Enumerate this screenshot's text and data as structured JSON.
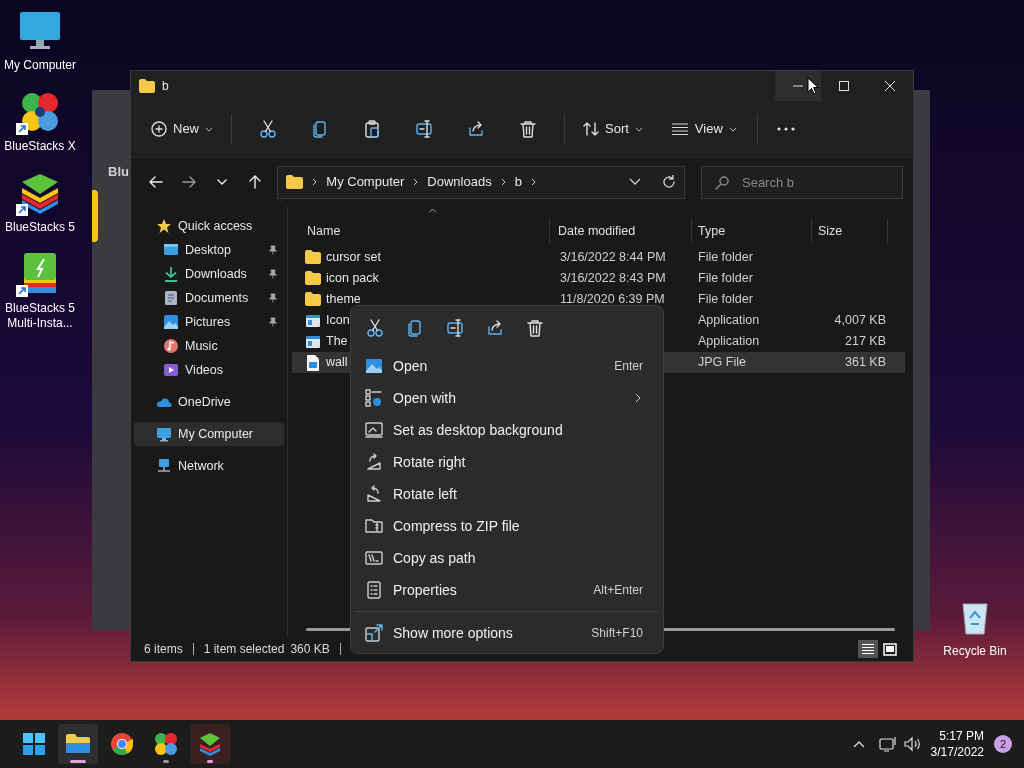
{
  "desktop_icons": [
    {
      "label": "My Computer",
      "kind": "monitor",
      "shortcut": false
    },
    {
      "label": "BlueStacks X",
      "kind": "bsx",
      "shortcut": true
    },
    {
      "label": "BlueStacks 5",
      "kind": "bs5",
      "shortcut": true
    },
    {
      "label": "BlueStacks 5 Multi-Insta...",
      "kind": "bs5multi",
      "shortcut": true
    }
  ],
  "recycle_bin": {
    "label": "Recycle Bin"
  },
  "background_window": {
    "text": "Blu"
  },
  "window": {
    "title": "b",
    "toolbar": {
      "new": "New",
      "sort": "Sort",
      "view": "View"
    },
    "address": {
      "segments": [
        "My Computer",
        "Downloads",
        "b"
      ]
    },
    "search": {
      "placeholder": "Search b"
    },
    "sidebar": [
      {
        "label": "Quick access",
        "kind": "star",
        "selected": false,
        "pinned": false,
        "children": [
          {
            "label": "Desktop",
            "kind": "desktop",
            "selected": false,
            "pinned": true
          },
          {
            "label": "Downloads",
            "kind": "download",
            "selected": false,
            "pinned": true
          },
          {
            "label": "Documents",
            "kind": "document",
            "selected": false,
            "pinned": true
          },
          {
            "label": "Pictures",
            "kind": "picture",
            "selected": false,
            "pinned": true
          },
          {
            "label": "Music",
            "kind": "music",
            "selected": false,
            "pinned": false
          },
          {
            "label": "Videos",
            "kind": "video",
            "selected": false,
            "pinned": false
          }
        ]
      },
      {
        "label": "OneDrive",
        "kind": "cloud",
        "selected": false,
        "pinned": false
      },
      {
        "label": "My Computer",
        "kind": "monitor",
        "selected": true,
        "pinned": false
      },
      {
        "label": "Network",
        "kind": "network",
        "selected": false,
        "pinned": false
      }
    ],
    "columns": [
      "Name",
      "Date modified",
      "Type",
      "Size"
    ],
    "rows": [
      {
        "name": "cursor set",
        "date": "3/16/2022 8:44 PM",
        "type": "File folder",
        "size": "",
        "kind": "folder",
        "selected": false
      },
      {
        "name": "icon pack",
        "date": "3/16/2022 8:43 PM",
        "type": "File folder",
        "size": "",
        "kind": "folder",
        "selected": false
      },
      {
        "name": "theme",
        "date": "11/8/2020 6:39 PM",
        "type": "File folder",
        "size": "",
        "kind": "folder",
        "selected": false
      },
      {
        "name": "Icon",
        "type": "Application",
        "size": "4,007 KB",
        "kind": "app",
        "selected": false
      },
      {
        "name": "The",
        "type": "Application",
        "size": "217 KB",
        "kind": "app",
        "selected": false
      },
      {
        "name": "wall",
        "type": "JPG File",
        "size": "361 KB",
        "kind": "image",
        "selected": true
      }
    ],
    "status": {
      "count": "6 items",
      "selection": "1 item selected",
      "selection_size": "360 KB"
    }
  },
  "context_menu": {
    "items": [
      {
        "label": "Open",
        "shortcut": "Enter",
        "kind": "image",
        "submenu": false
      },
      {
        "label": "Open with",
        "kind": "openwith",
        "submenu": true
      },
      {
        "label": "Set as desktop background",
        "kind": "wallpaper",
        "submenu": false
      },
      {
        "label": "Rotate right",
        "kind": "rotr",
        "submenu": false
      },
      {
        "label": "Rotate left",
        "kind": "rotl",
        "submenu": false
      },
      {
        "label": "Compress to ZIP file",
        "kind": "zip",
        "submenu": false
      },
      {
        "label": "Copy as path",
        "kind": "path",
        "submenu": false
      },
      {
        "label": "Properties",
        "shortcut": "Alt+Enter",
        "kind": "props",
        "submenu": false
      }
    ],
    "footer": {
      "label": "Show more options",
      "shortcut": "Shift+F10"
    }
  },
  "taskbar": {
    "apps": [
      {
        "kind": "start",
        "running": false,
        "active": false
      },
      {
        "kind": "explorer",
        "running": true,
        "active": true
      },
      {
        "kind": "chrome",
        "running": false,
        "active": false
      },
      {
        "kind": "bsx",
        "running": true,
        "active": false
      },
      {
        "kind": "bs5",
        "running": true,
        "active": true
      }
    ],
    "time": "5:17 PM",
    "date": "3/17/2022",
    "notifications": "2"
  }
}
